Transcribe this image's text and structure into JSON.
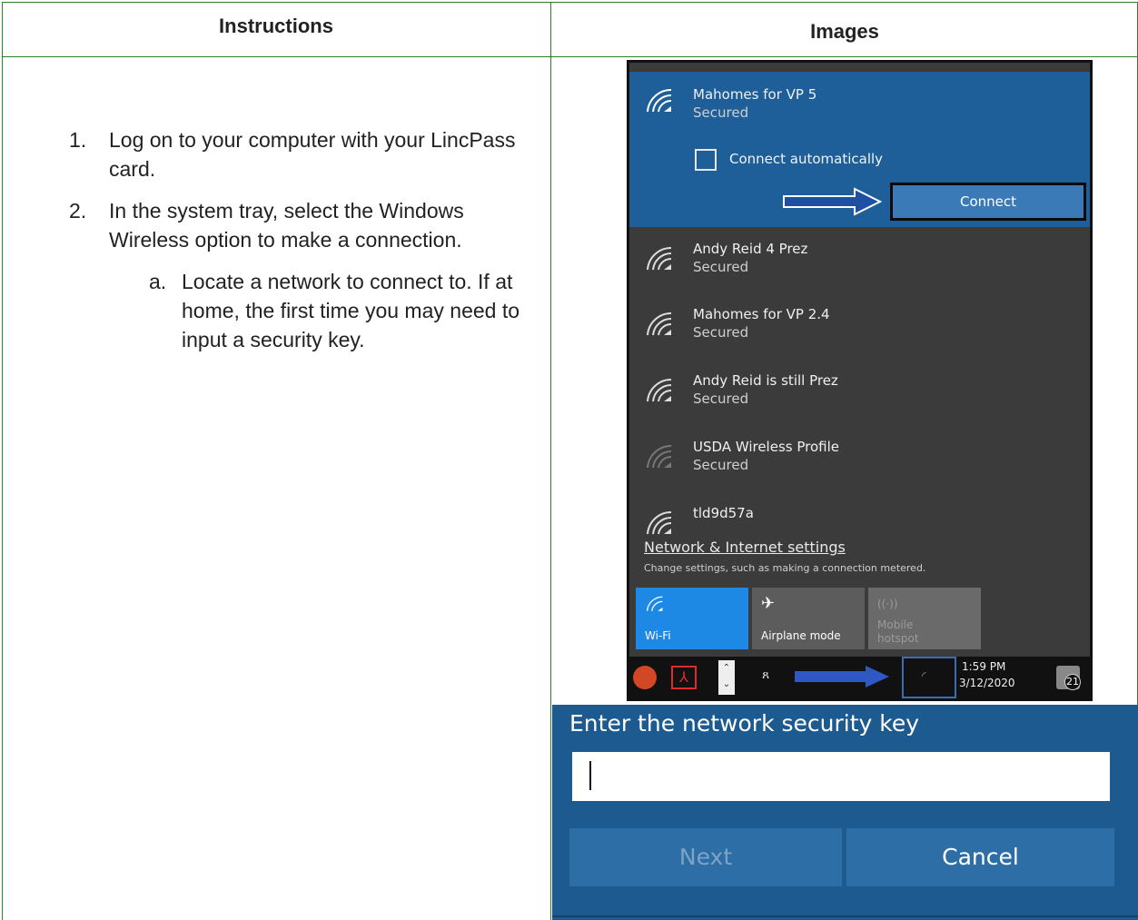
{
  "table": {
    "header_instructions": "Instructions",
    "header_images": "Images"
  },
  "steps": [
    {
      "number": "1.",
      "text": "Log on to your computer with your LincPass card."
    },
    {
      "number": "2.",
      "text": "In the system tray, select the Windows Wireless option to make a connection."
    }
  ],
  "substeps": [
    {
      "letter": "a.",
      "text": "Locate a network to connect to. If at home, the first time you may need to input a security key."
    }
  ],
  "flyout": {
    "networks": [
      {
        "name": "Mahomes for VP 5",
        "status": "Secured"
      },
      {
        "name": "Andy Reid 4 Prez",
        "status": "Secured"
      },
      {
        "name": "Mahomes for VP 2.4",
        "status": "Secured"
      },
      {
        "name": "Andy Reid is still Prez",
        "status": "Secured"
      },
      {
        "name": "USDA Wireless Profile",
        "status": "Secured"
      },
      {
        "name": "tld9d57a",
        "status": ""
      }
    ],
    "connect_automatically": "Connect automatically",
    "connect_button": "Connect",
    "settings_link": "Network & Internet settings",
    "settings_desc": "Change settings, such as making a connection metered.",
    "quick_actions": [
      "Wi-Fi",
      "Airplane mode",
      "Mobile hotspot"
    ],
    "taskbar_time": "1:59 PM",
    "taskbar_date": "3/12/2020",
    "notification_count": "21",
    "colors": {
      "active": "#1e5f9a",
      "panel": "#3b3b3b",
      "wifi_tile": "#1e88e5"
    }
  },
  "security_dialog": {
    "title": "Enter the network security key",
    "input_value": "",
    "next_button": "Next",
    "cancel_button": "Cancel",
    "colors": {
      "background": "#1c5a8f",
      "button": "#2e6ea6"
    }
  }
}
